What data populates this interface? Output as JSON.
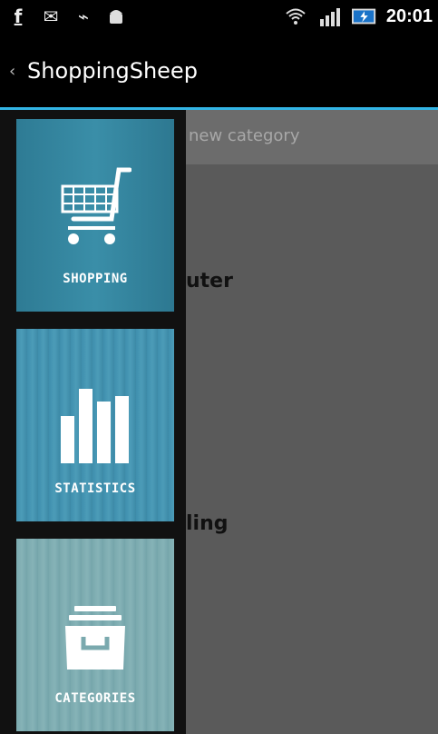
{
  "status_bar": {
    "left_icons": [
      "facebook-icon",
      "gmail-icon",
      "usb-icon",
      "android-debug-icon"
    ],
    "right_icons": [
      "wifi-icon",
      "signal-icon",
      "battery-icon"
    ],
    "time": "20:01"
  },
  "action_bar": {
    "back_glyph": "‹",
    "title": "ShoppingSheep"
  },
  "content": {
    "new_category_placeholder": "new category",
    "partial_items": [
      "uter",
      "ling"
    ]
  },
  "drawer": {
    "items": [
      {
        "label": "SHOPPING",
        "icon": "shopping-cart-icon"
      },
      {
        "label": "STATISTICS",
        "icon": "bar-chart-icon"
      },
      {
        "label": "CATEGORIES",
        "icon": "archive-box-icon"
      }
    ]
  }
}
